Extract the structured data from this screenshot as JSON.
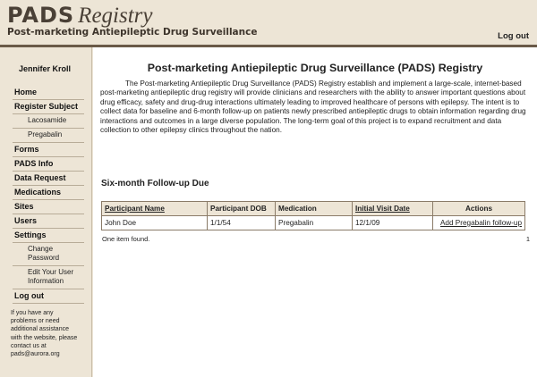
{
  "header": {
    "logo_pads": "PADS",
    "logo_registry": "Registry",
    "subtitle": "Post-marketing Antiepileptic Drug Surveillance",
    "logout": "Log out"
  },
  "sidebar": {
    "user_name": "Jennifer Kroll",
    "items": [
      {
        "label": "Home"
      },
      {
        "label": "Register Subject"
      },
      {
        "label": "Lacosamide"
      },
      {
        "label": "Pregabalin"
      },
      {
        "label": "Forms"
      },
      {
        "label": "PADS Info"
      },
      {
        "label": "Data Request"
      },
      {
        "label": "Medications"
      },
      {
        "label": "Sites"
      },
      {
        "label": "Users"
      },
      {
        "label": "Settings"
      },
      {
        "label": "Change Password"
      },
      {
        "label": "Edit Your User Information"
      },
      {
        "label": "Log out"
      }
    ],
    "help_text": "If you have any problems or need additional assistance with the website, please contact us at pads@aurora.org"
  },
  "main": {
    "title": "Post-marketing Antiepileptic Drug Surveillance (PADS) Registry",
    "intro": "The Post-marketing Antiepileptic Drug Surveillance (PADS) Registry establish and implement a large-scale, internet-based post-marketing antiepileptic drug registry will provide clinicians and researchers with the ability to answer important questions about drug efficacy, safety and drug-drug interactions ultimately leading to improved healthcare of persons with epilepsy. The intent is to collect data for baseline and 6-month follow-up on patients newly prescribed antiepileptic drugs to obtain information regarding drug interactions and outcomes in a large diverse population. The long-term goal of this project is to expand recruitment and data collection to other epilepsy clinics throughout the nation.",
    "section_title": "Six-month Follow-up Due",
    "table": {
      "headers": [
        "Participant Name",
        "Participant DOB",
        "Medication",
        "Initial Visit Date",
        "Actions"
      ],
      "rows": [
        [
          "John Doe",
          "1/1/54",
          "Pregabalin",
          "12/1/09",
          "Add Pregabalin follow-up"
        ]
      ]
    },
    "found_text": "One item found.",
    "page_number": "1"
  }
}
